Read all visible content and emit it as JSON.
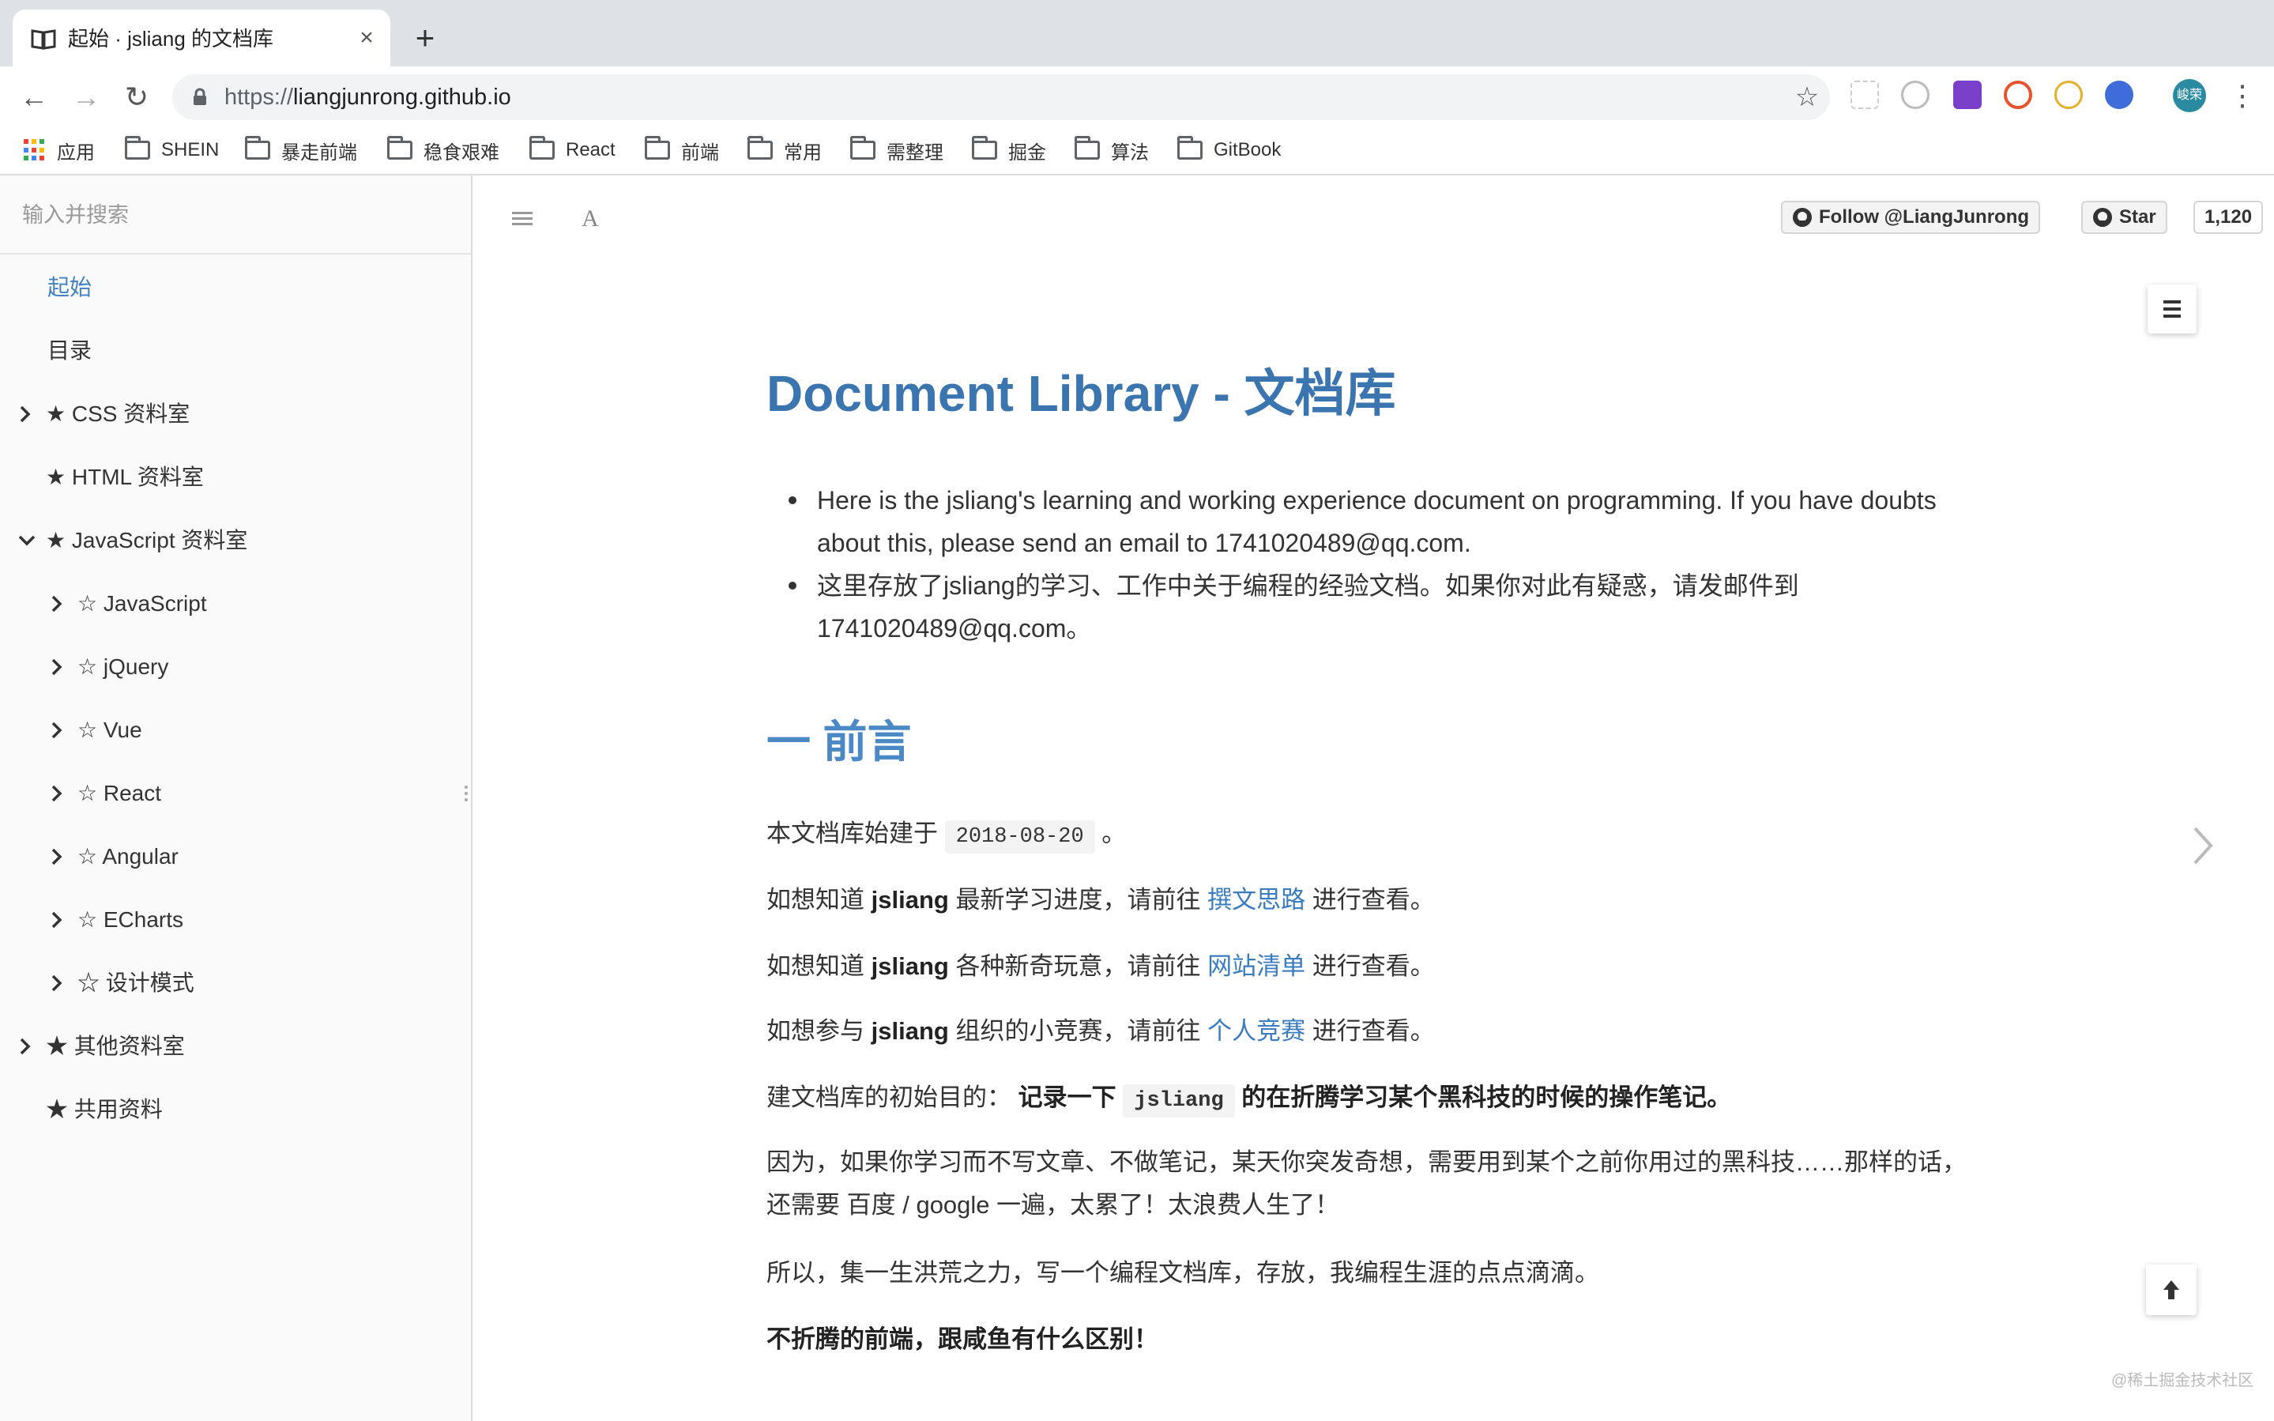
{
  "browser": {
    "tab_title": "起始 · jsliang 的文档库",
    "tab_close": "×",
    "new_tab": "+",
    "url_scheme": "https://",
    "url_host": "liangjunrong.github.io",
    "profile_label": "峻荣",
    "bookmarks": [
      "应用",
      "SHEIN",
      "暴走前端",
      "稳食艰难",
      "React",
      "前端",
      "常用",
      "需整理",
      "掘金",
      "算法",
      "GitBook"
    ]
  },
  "sidebar": {
    "search_placeholder": "输入并搜索",
    "items": [
      {
        "label": "起始"
      },
      {
        "label": "目录"
      },
      {
        "label": "★ CSS 资料室"
      },
      {
        "label": "★ HTML 资料室"
      },
      {
        "label": "★ JavaScript 资料室"
      },
      {
        "label": "☆ JavaScript"
      },
      {
        "label": "☆ jQuery"
      },
      {
        "label": "☆ Vue"
      },
      {
        "label": "☆ React"
      },
      {
        "label": "☆ Angular"
      },
      {
        "label": "☆ ECharts"
      },
      {
        "label": "☆ 设计模式"
      },
      {
        "label": "★ 其他资料室"
      },
      {
        "label": "★ 共用资料"
      }
    ]
  },
  "topbar": {
    "follow_label": "Follow @LiangJunrong",
    "star_label": "Star",
    "star_count": "1,120"
  },
  "content": {
    "title": "Document Library - 文档库",
    "intro": [
      "Here is the jsliang's learning and working experience document on programming. If you have doubts about this, please send an email to 1741020489@qq.com.",
      "这里存放了jsliang的学习、工作中关于编程的经验文档。如果你对此有疑惑，请发邮件到1741020489@qq.com。"
    ],
    "section_title": "一 前言",
    "p1_prefix": "本文档库始建于",
    "p1_code": "2018-08-20",
    "p1_suffix": "。",
    "p2_prefix": "如想知道",
    "p2_bold": "jsliang",
    "p2_mid": "最新学习进度，请前往",
    "p2_link": "撰文思路",
    "p2_suffix": "进行查看。",
    "p3_prefix": "如想知道",
    "p3_bold": "jsliang",
    "p3_mid": "各种新奇玩意，请前往",
    "p3_link": "网站清单",
    "p3_suffix": "进行查看。",
    "p4_prefix": "如想参与",
    "p4_bold": "jsliang",
    "p4_mid": "组织的小竞赛，请前往",
    "p4_link": "个人竞赛",
    "p4_suffix": "进行查看。",
    "p5_prefix": "建文档库的初始目的：",
    "p5_bold1": "记录一下",
    "p5_code": "jsliang",
    "p5_bold2": "的在折腾学习某个黑科技的时候的操作笔记。",
    "p6": "因为，如果你学习而不写文章、不做笔记，某天你突发奇想，需要用到某个之前你用过的黑科技……那样的话，还需要 百度 / google 一遍，太累了！太浪费人生了！",
    "p7": "所以，集一生洪荒之力，写一个编程文档库，存放，我编程生涯的点点滴滴。",
    "p8": "不折腾的前端，跟咸鱼有什么区别！"
  },
  "watermark": "@稀土掘金技术社区",
  "colors": {
    "accent": "#3a75b0",
    "link": "#3a7cc0",
    "sidebar_bg": "#fafafa",
    "tabstrip_bg": "#dee1e6"
  }
}
